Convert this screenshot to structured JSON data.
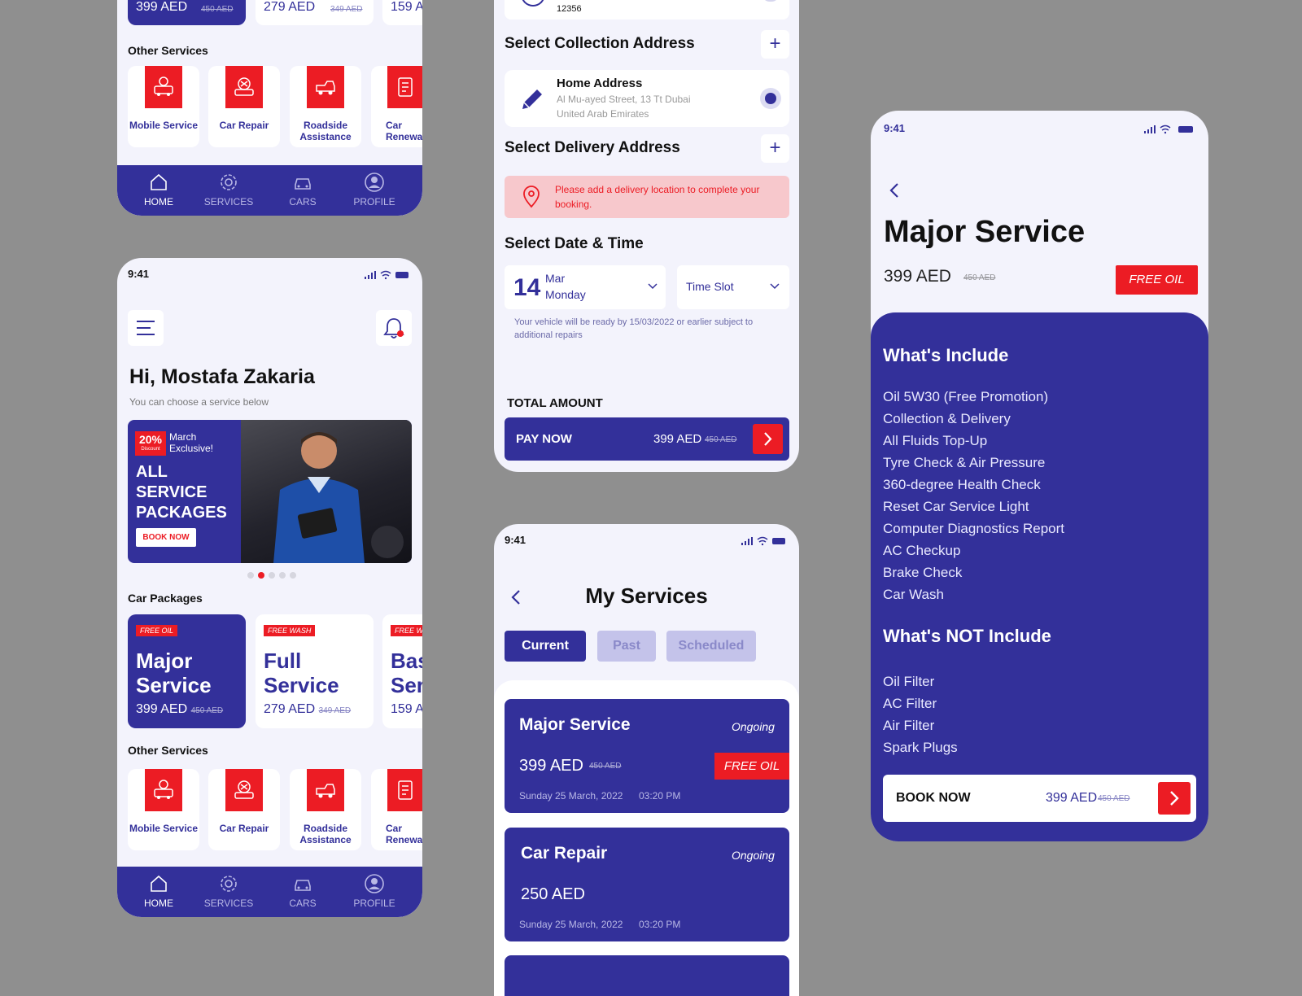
{
  "colors": {
    "brand": "#33309a",
    "accent": "#ec1c24",
    "bg": "#8f8f8f",
    "screen": "#f3f3fc"
  },
  "status_time": "9:41",
  "home_top": {
    "packages": [
      {
        "price": "399 AED",
        "old": "450 AED"
      },
      {
        "price": "279 AED",
        "old": "349 AED"
      },
      {
        "price": "159 A"
      }
    ]
  },
  "other_services_title": "Other Services",
  "other_services": [
    {
      "label": "Mobile Service",
      "icon": "mobile-service-icon"
    },
    {
      "label": "Car Repair",
      "icon": "car-repair-icon"
    },
    {
      "label": "Roadside Assistance",
      "icon": "roadside-icon"
    },
    {
      "label": "Car Renewa",
      "icon": "renewal-icon"
    }
  ],
  "nav": {
    "home": "HOME",
    "services": "SERVICES",
    "cars": "CARS",
    "profile": "PROFILE"
  },
  "home": {
    "greeting": "Hi, Mostafa Zakaria",
    "subtitle": "You can choose a service below",
    "banner": {
      "badge_pct": "20%",
      "badge_sub": "Discount",
      "promo": "March Exclusive!",
      "headline_1": "ALL",
      "headline_2": "SERVICE",
      "headline_3": "PACKAGES",
      "cta": "BOOK NOW"
    },
    "packages_title": "Car Packages",
    "packages": [
      {
        "tag": "FREE OIL",
        "title_1": "Major",
        "title_2": "Service",
        "price": "399 AED",
        "old": "450 AED"
      },
      {
        "tag": "FREE WASH",
        "title_1": "Full",
        "title_2": "Service",
        "price": "279 AED",
        "old": "349 AED"
      },
      {
        "tag": "FREE WA",
        "title_1": "Bas",
        "title_2": "Ser",
        "price": "159 A"
      }
    ]
  },
  "booking": {
    "vehicle_code": "12356",
    "collection_title": "Select Collection Address",
    "address_title": "Home Address",
    "address_line_1": "Al Mu-ayed Street, 13 Tt Dubai",
    "address_line_2": "United Arab Emirates",
    "delivery_title": "Select Delivery Address",
    "alert": "Please add a delivery location to complete your booking.",
    "datetime_title": "Select Date & Time",
    "day": "14",
    "month": "Mar",
    "weekday": "Monday",
    "time_slot": "Time Slot",
    "note": "Your vehicle will be ready by 15/03/2022 or earlier subject to additional repairs",
    "total_label": "TOTAL AMOUNT",
    "pay_label": "PAY NOW",
    "price": "399 AED",
    "old_price": "450 AED"
  },
  "my_services": {
    "title": "My Services",
    "tabs": [
      "Current",
      "Past",
      "Scheduled"
    ],
    "cards": [
      {
        "title": "Major Service",
        "status": "Ongoing",
        "price": "399 AED",
        "old": "450 AED",
        "tag": "FREE OIL",
        "date": "Sunday 25 March, 2022",
        "time": "03:20 PM"
      },
      {
        "title": "Car Repair",
        "status": "Ongoing",
        "price": "250 AED",
        "date": "Sunday 25 March, 2022",
        "time": "03:20 PM"
      }
    ]
  },
  "detail": {
    "title": "Major Service",
    "price": "399 AED",
    "old": "450 AED",
    "tag": "FREE OIL",
    "include_title": "What's Include",
    "includes": [
      "Oil 5W30 (Free Promotion)",
      "Collection & Delivery",
      "All Fluids Top-Up",
      "Tyre Check & Air Pressure",
      "360-degree Health Check",
      "Reset Car Service Light",
      "Computer Diagnostics Report",
      "AC Checkup",
      "Brake Check",
      "Car Wash"
    ],
    "exclude_title": "What's NOT Include",
    "excludes": [
      "Oil Filter",
      "AC Filter",
      "Air Filter",
      "Spark Plugs"
    ],
    "book_label": "BOOK NOW"
  }
}
